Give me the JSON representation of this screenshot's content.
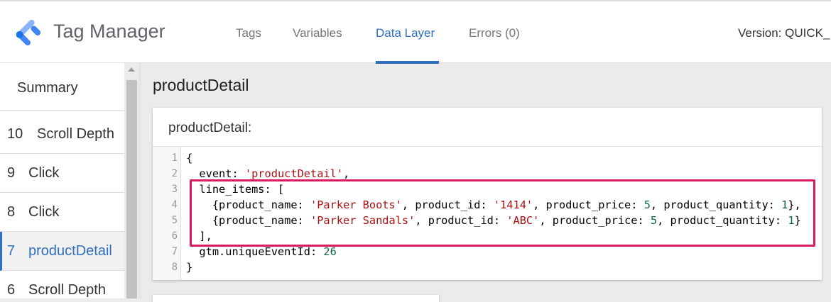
{
  "app": {
    "title": "Tag Manager"
  },
  "nav": {
    "tabs": [
      {
        "label": "Tags"
      },
      {
        "label": "Variables"
      },
      {
        "label": "Data Layer"
      },
      {
        "label": "Errors (0)"
      }
    ],
    "version": "Version: QUICK_"
  },
  "sidebar": {
    "summary": "Summary",
    "items": [
      {
        "num": "10",
        "label": "Scroll Depth"
      },
      {
        "num": "9",
        "label": "Click"
      },
      {
        "num": "8",
        "label": "Click"
      },
      {
        "num": "7",
        "label": "productDetail"
      },
      {
        "num": "6",
        "label": "Scroll Depth"
      }
    ]
  },
  "main": {
    "title": "productDetail",
    "card_title": "productDetail:",
    "code": {
      "line_numbers": [
        "1",
        "2",
        "3",
        "4",
        "5",
        "6",
        "7",
        "8"
      ],
      "l1": "{",
      "l2a": "  event: ",
      "l2b": "'productDetail'",
      "l2c": ",",
      "l3": "  line_items: [",
      "l4a": "    {product_name: ",
      "l4b": "'Parker Boots'",
      "l4c": ", product_id: ",
      "l4d": "'1414'",
      "l4e": ", product_price: ",
      "l4f": "5",
      "l4g": ", product_quantity: ",
      "l4h": "1",
      "l4i": "},",
      "l5a": "    {product_name: ",
      "l5b": "'Parker Sandals'",
      "l5c": ", product_id: ",
      "l5d": "'ABC'",
      "l5e": ", product_price: ",
      "l5f": "5",
      "l5g": ", product_quantity: ",
      "l5h": "1",
      "l5i": "}",
      "l6": "  ],",
      "l7a": "  gtm.uniqueEventId: ",
      "l7b": "26",
      "l8": "}"
    }
  },
  "colors": {
    "accent": "#2f6fbf",
    "highlight_border": "#d81b60",
    "string": "#aa1111",
    "number": "#116644"
  }
}
